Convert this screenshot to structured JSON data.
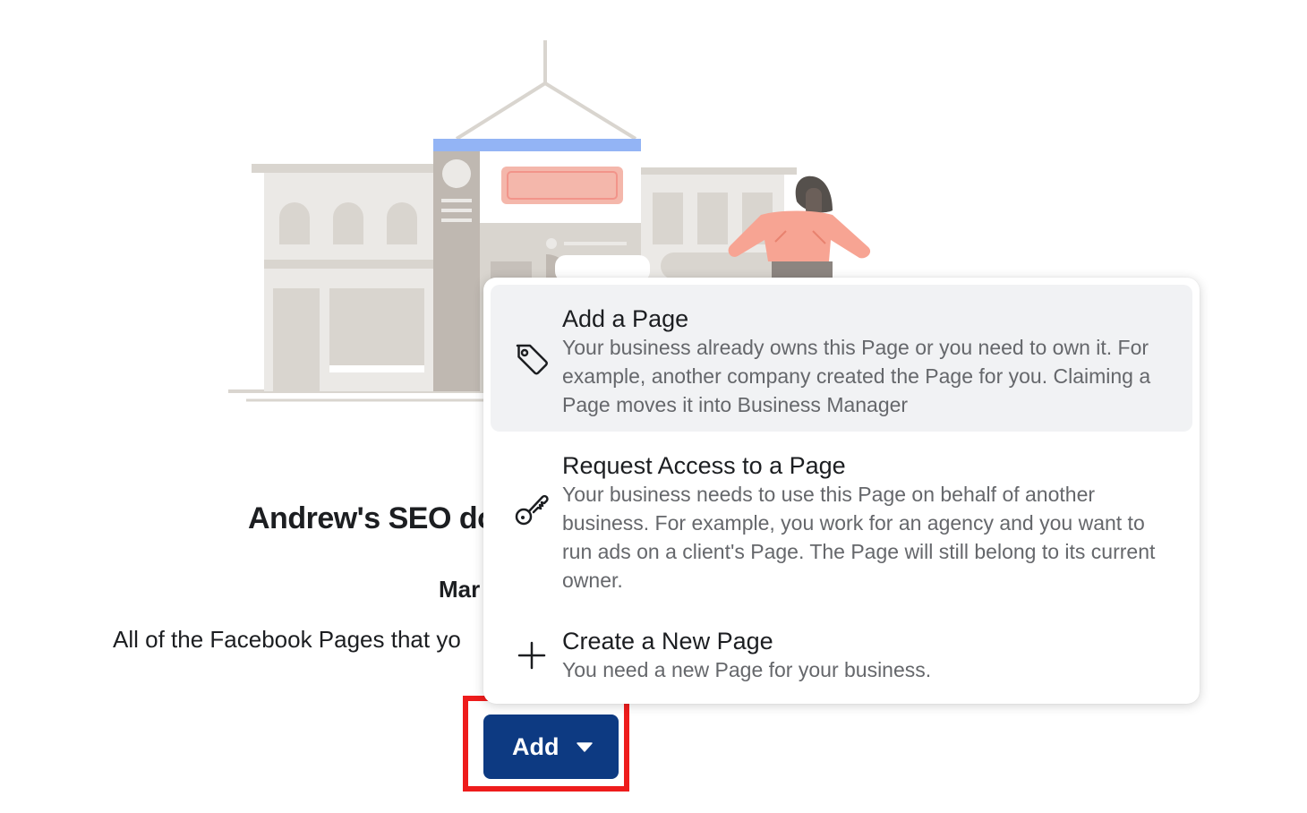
{
  "page": {
    "business_name": "Andrew's SEO do",
    "section_heading": "Mar",
    "section_description": "All of the Facebook Pages that yo"
  },
  "add_button": {
    "label": "Add",
    "icon": "caret-down-icon",
    "color": "#0d3a82"
  },
  "highlight": {
    "color": "#ee1c1c"
  },
  "dropdown": {
    "items": [
      {
        "icon": "tag-icon",
        "title": "Add a Page",
        "description": "Your business already owns this Page or you need to own it. For example, another company created the Page for you. Claiming a Page moves it into Business Manager"
      },
      {
        "icon": "key-icon",
        "title": "Request Access to a Page",
        "description": "Your business needs to use this Page on behalf of another business. For example, you work for an agency and you want to run ads on a client's Page. The Page will still belong to its current owner."
      },
      {
        "icon": "plus-icon",
        "title": "Create a New Page",
        "description": "You need a new Page for your business."
      }
    ]
  }
}
